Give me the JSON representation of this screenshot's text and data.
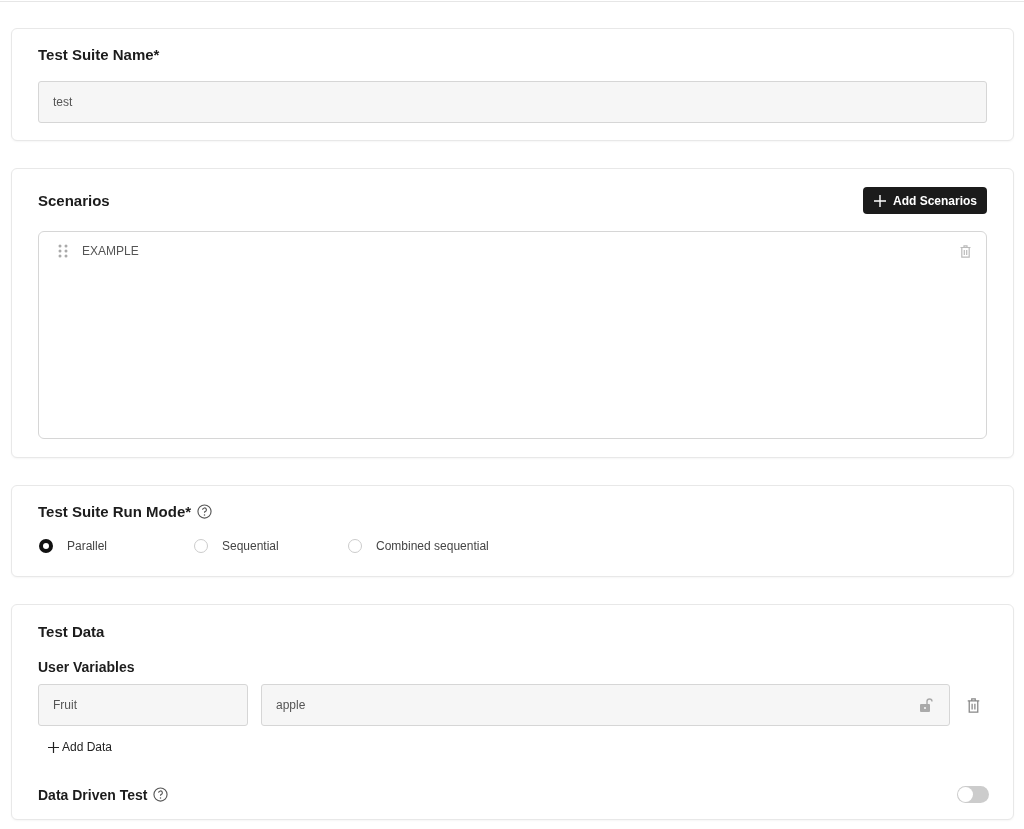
{
  "suite_name": {
    "label": "Test Suite Name*",
    "value": "test"
  },
  "scenarios": {
    "title": "Scenarios",
    "add_button": "Add Scenarios",
    "items": [
      {
        "name": "EXAMPLE"
      }
    ]
  },
  "run_mode": {
    "title": "Test Suite Run Mode*",
    "options": [
      {
        "label": "Parallel",
        "selected": true
      },
      {
        "label": "Sequential",
        "selected": false
      },
      {
        "label": "Combined sequential",
        "selected": false
      }
    ]
  },
  "test_data": {
    "title": "Test Data",
    "subtitle": "User Variables",
    "variables": [
      {
        "name": "Fruit",
        "value": "apple",
        "locked": false
      }
    ],
    "add_button": "Add Data",
    "data_driven": {
      "label": "Data Driven Test",
      "on": false
    }
  }
}
